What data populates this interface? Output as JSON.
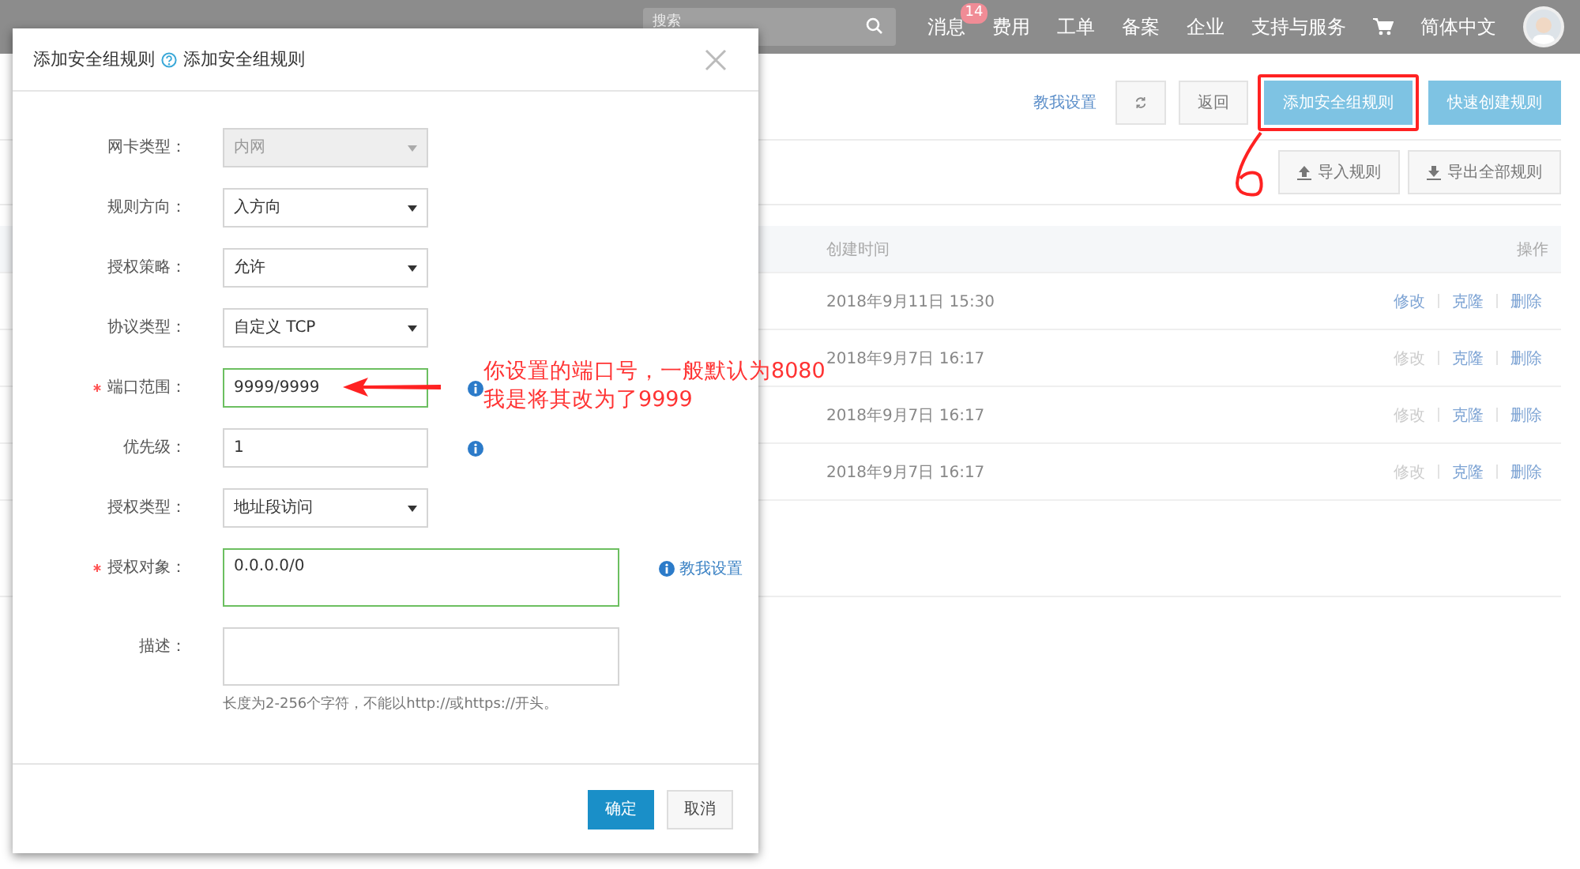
{
  "top_bar": {
    "search": {
      "placeholder": "搜索"
    },
    "nav": [
      {
        "label": "消息",
        "badge": "14"
      },
      {
        "label": "费用"
      },
      {
        "label": "工单"
      },
      {
        "label": "备案"
      },
      {
        "label": "企业"
      },
      {
        "label": "支持与服务"
      }
    ],
    "language": "简体中文"
  },
  "toolbar": {
    "help_link": "教我设置",
    "buttons": [
      {
        "label": "返回",
        "kind": "default",
        "highlighted": false
      },
      {
        "label": "添加安全组规则",
        "kind": "primary",
        "highlighted": true
      },
      {
        "label": "快速创建规则",
        "kind": "primary",
        "highlighted": false
      }
    ]
  },
  "secondary_buttons": [
    {
      "label": "导入规则",
      "kind": "import"
    },
    {
      "label": "导出全部规则",
      "kind": "export"
    }
  ],
  "table": {
    "columns": [
      "创建时间",
      "操作"
    ],
    "rows": [
      {
        "created": "2018年9月11日 15:30",
        "actions": [
          {
            "label": "修改",
            "disabled": false
          },
          {
            "label": "克隆",
            "disabled": false
          },
          {
            "label": "删除",
            "disabled": false
          }
        ]
      },
      {
        "created": "2018年9月7日 16:17",
        "actions": [
          {
            "label": "修改",
            "disabled": true
          },
          {
            "label": "克隆",
            "disabled": false
          },
          {
            "label": "删除",
            "disabled": false
          }
        ]
      },
      {
        "created": "2018年9月7日 16:17",
        "actions": [
          {
            "label": "修改",
            "disabled": true
          },
          {
            "label": "克隆",
            "disabled": false
          },
          {
            "label": "删除",
            "disabled": false
          }
        ]
      },
      {
        "created": "2018年9月7日 16:17",
        "actions": [
          {
            "label": "修改",
            "disabled": true
          },
          {
            "label": "克隆",
            "disabled": false
          },
          {
            "label": "删除",
            "disabled": false
          }
        ]
      }
    ]
  },
  "dialog": {
    "title": "添加安全组规则",
    "help_link": "添加安全组规则",
    "fields": [
      {
        "label": "网卡类型：",
        "kind": "select",
        "value": "内网",
        "disabled": true,
        "required": false,
        "valid": false,
        "info": false
      },
      {
        "label": "规则方向：",
        "kind": "select",
        "value": "入方向",
        "disabled": false,
        "required": false,
        "valid": false,
        "info": false
      },
      {
        "label": "授权策略：",
        "kind": "select",
        "value": "允许",
        "disabled": false,
        "required": false,
        "valid": false,
        "info": false
      },
      {
        "label": "协议类型：",
        "kind": "select",
        "value": "自定义 TCP",
        "disabled": false,
        "required": false,
        "valid": false,
        "info": false
      },
      {
        "label": "端口范围：",
        "kind": "input",
        "value": "9999/9999",
        "disabled": false,
        "required": true,
        "valid": true,
        "info": true
      },
      {
        "label": "优先级：",
        "kind": "input",
        "value": "1",
        "disabled": false,
        "required": false,
        "valid": false,
        "info": true
      },
      {
        "label": "授权类型：",
        "kind": "select",
        "value": "地址段访问",
        "disabled": false,
        "required": false,
        "valid": false,
        "info": false
      },
      {
        "label": "授权对象：",
        "kind": "textarea",
        "value": "0.0.0.0/0",
        "disabled": false,
        "required": true,
        "valid": true,
        "info": false,
        "help_link": "教我设置"
      },
      {
        "label": "描述：",
        "kind": "textarea",
        "disabled": false,
        "required": false,
        "valid": false,
        "info": false
      }
    ],
    "hint": "长度为2-256个字符，不能以http://或https://开头。",
    "buttons": [
      {
        "label": "确定",
        "kind": "primary"
      },
      {
        "label": "取消",
        "kind": "default"
      }
    ]
  },
  "annotation": {
    "lines": [
      "你设置的端口号，一般默认为8080",
      "我是将其改为了9999"
    ]
  }
}
